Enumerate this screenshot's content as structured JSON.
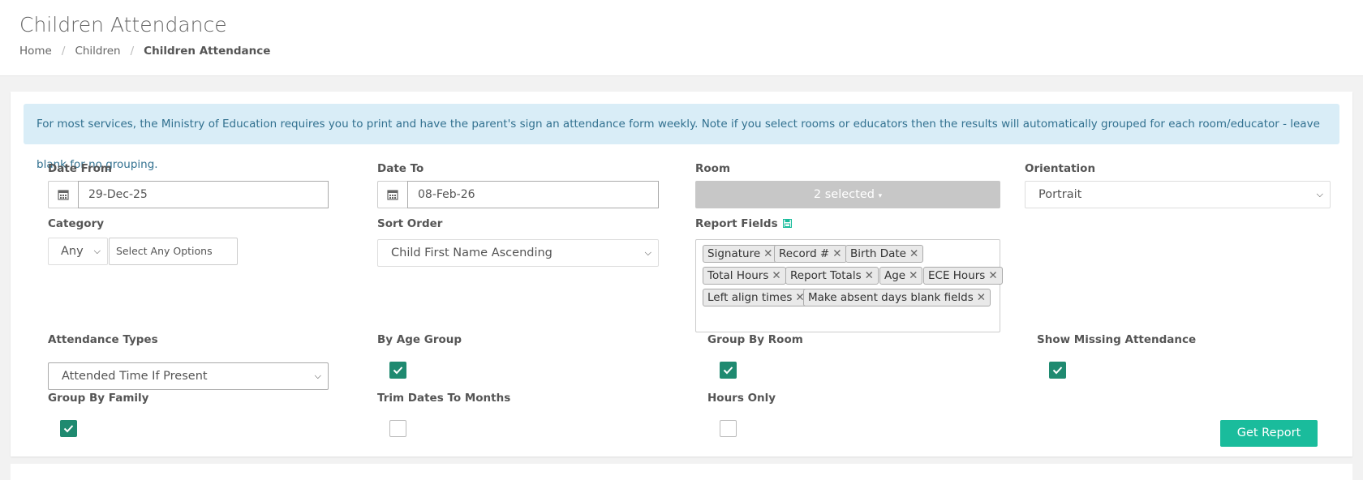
{
  "header": {
    "title": "Children Attendance",
    "breadcrumb": [
      "Home",
      "Children",
      "Children Attendance"
    ]
  },
  "alert": {
    "text": "For most services, the Ministry of Education requires you to print and have the parent's sign an attendance form weekly. Note if you select rooms or educators then the results will automatically grouped for each room/educator - leave blank for no grouping."
  },
  "form": {
    "date_from": {
      "label": "Date From",
      "value": "29-Dec-25",
      "icon": "calendar-icon"
    },
    "date_to": {
      "label": "Date To",
      "value": "08-Feb-26",
      "icon": "calendar-icon"
    },
    "room": {
      "label": "Room",
      "value": "2 selected"
    },
    "orientation": {
      "label": "Orientation",
      "value": "Portrait"
    },
    "category": {
      "label": "Category",
      "value": "Any",
      "options_placeholder": "Select Any Options"
    },
    "sort_order": {
      "label": "Sort Order",
      "value": "Child First Name Ascending"
    },
    "report_fields": {
      "label": "Report Fields",
      "icon": "save-icon",
      "tags": [
        "Signature",
        "Record #",
        "Birth Date",
        "Total Hours",
        "Report Totals",
        "Age",
        "ECE Hours",
        "Left align times",
        "Make absent days blank fields"
      ]
    },
    "attendance_types": {
      "label": "Attendance Types",
      "value": "Attended Time If Present"
    },
    "by_age_group": {
      "label": "By Age Group",
      "checked": true
    },
    "group_by_room": {
      "label": "Group By Room",
      "checked": true
    },
    "show_missing_attendance": {
      "label": "Show Missing Attendance",
      "checked": true
    },
    "group_by_family": {
      "label": "Group By Family",
      "checked": true
    },
    "trim_dates_to_months": {
      "label": "Trim Dates To Months",
      "checked": false
    },
    "hours_only": {
      "label": "Hours Only",
      "checked": false
    },
    "submit_label": "Get Report"
  },
  "colors": {
    "accent": "#1abc9c",
    "checkbox": "#1f8a70",
    "alert_bg": "#d9edf7",
    "alert_text": "#31708f",
    "multiselect_bg": "#c7c7c7"
  }
}
